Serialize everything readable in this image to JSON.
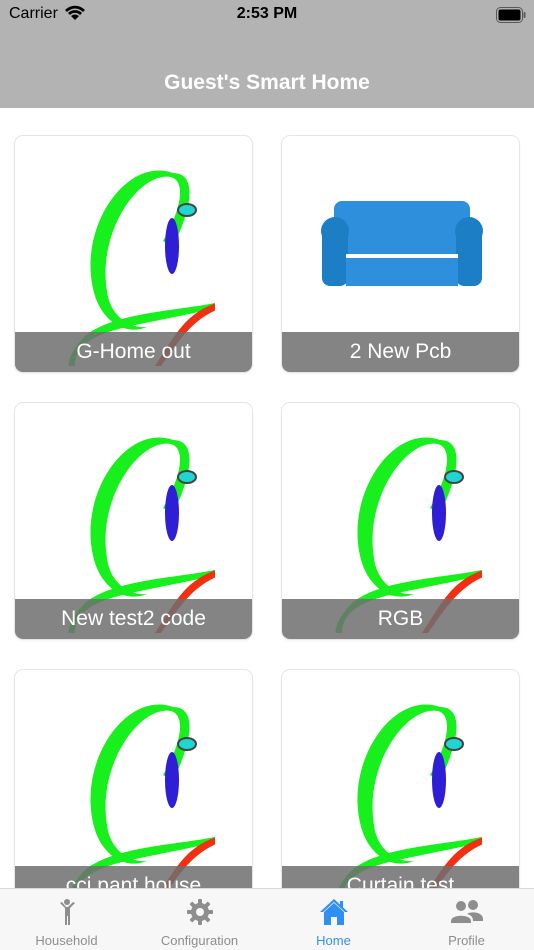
{
  "status_bar": {
    "carrier": "Carrier",
    "time": "2:53 PM"
  },
  "header": {
    "title": "Guest's Smart Home"
  },
  "devices": [
    {
      "name": "G-Home out",
      "icon": "g-logo-icon"
    },
    {
      "name": "2 New Pcb",
      "icon": "sofa-icon"
    },
    {
      "name": "New test2 code",
      "icon": "g-logo-icon"
    },
    {
      "name": "RGB",
      "icon": "g-logo-icon"
    },
    {
      "name": "cci pant house",
      "icon": "g-logo-icon"
    },
    {
      "name": "Curtain test",
      "icon": "g-logo-icon"
    }
  ],
  "tabbar": {
    "tabs": [
      {
        "label": "Household",
        "icon": "person-icon",
        "active": false
      },
      {
        "label": "Configuration",
        "icon": "gear-icon",
        "active": false
      },
      {
        "label": "Home",
        "icon": "house-icon",
        "active": true
      },
      {
        "label": "Profile",
        "icon": "people-icon",
        "active": false
      }
    ]
  },
  "colors": {
    "accent": "#2f8ff5",
    "header": "#b3b3b3",
    "label_bg": "#6e6e6e"
  }
}
